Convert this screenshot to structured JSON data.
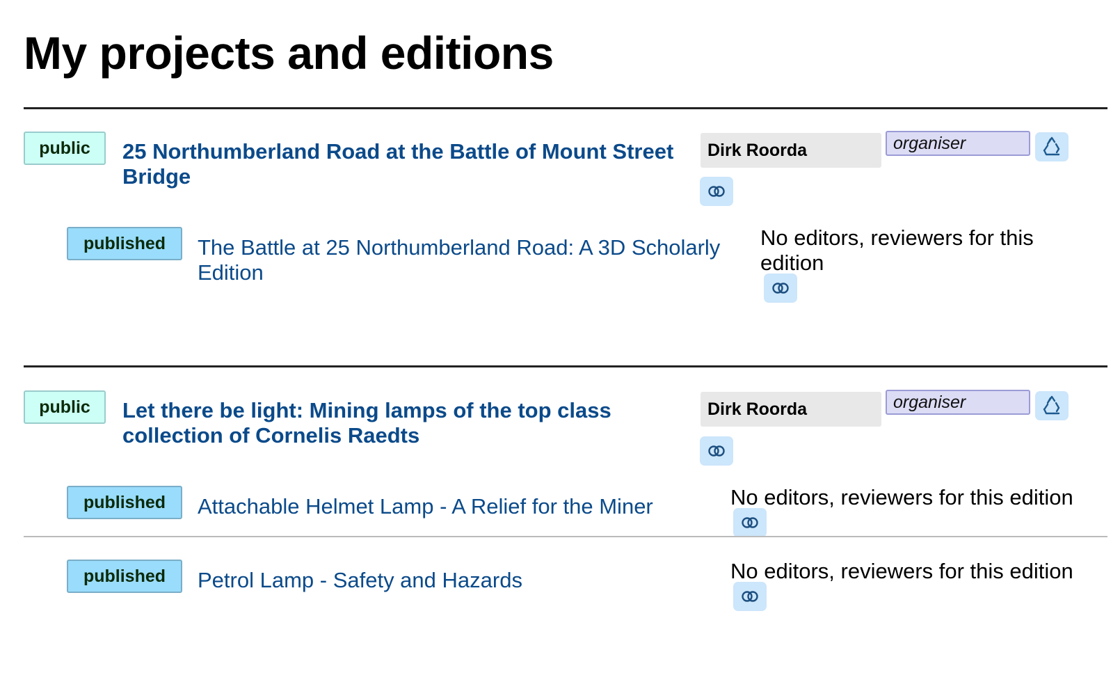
{
  "page": {
    "title": "My projects and editions"
  },
  "projects": [
    {
      "status": "public",
      "title": "25 Northumberland Road at the Battle of Mount Street Bridge",
      "user": "Dirk Roorda",
      "role": "organiser",
      "editions": [
        {
          "status": "published",
          "title": "The Battle at 25 Northumberland Road: A 3D Scholarly Edition",
          "editors_text": "No editors, reviewers for this edition"
        }
      ]
    },
    {
      "status": "public",
      "title": "Let there be light: Mining lamps of the top class collection of Cornelis Raedts",
      "user": "Dirk Roorda",
      "role": "organiser",
      "editions": [
        {
          "status": "published",
          "title": "Attachable Helmet Lamp - A Relief for the Miner",
          "editors_text": "No editors, reviewers for this edition"
        },
        {
          "status": "published",
          "title": "Petrol Lamp - Safety and Hazards",
          "editors_text": "No editors, reviewers for this edition"
        }
      ]
    }
  ],
  "icons": {
    "recycle": "recycle-icon",
    "link": "linked-rings-icon"
  },
  "colors": {
    "link": "#0b4a8a",
    "public_badge": "#ccfff5",
    "published_badge": "#99dcfb",
    "role_field": "#dcdcf5",
    "icon_button": "#cce6fb"
  }
}
